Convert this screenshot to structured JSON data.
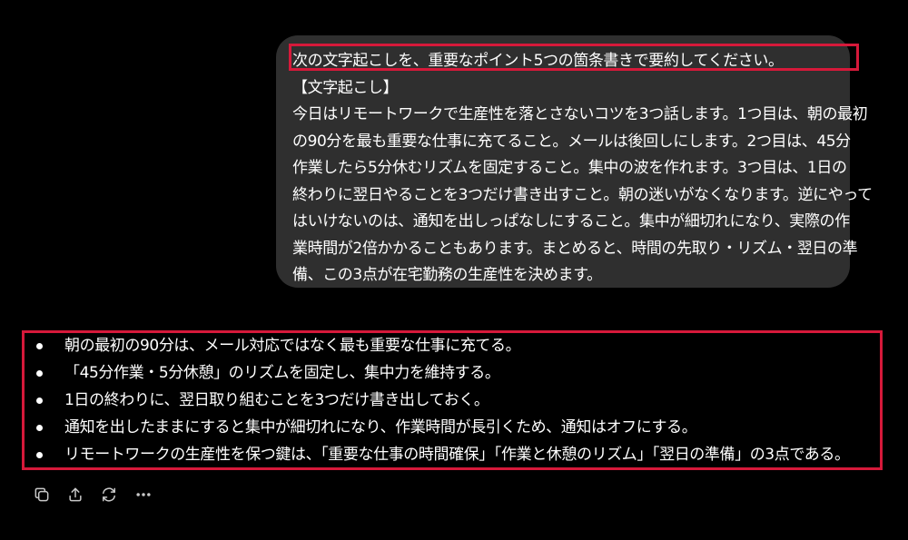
{
  "user_message": {
    "lines": [
      "次の文字起こしを、重要なポイント5つの箇条書きで要約してください。",
      "【文字起こし】",
      "今日はリモートワークで生産性を落とさないコツを3つ話します。1つ目は、朝の最初",
      "の90分を最も重要な仕事に充てること。メールは後回しにします。2つ目は、45分",
      "作業したら5分休むリズムを固定すること。集中の波を作れます。3つ目は、1日の",
      "終わりに翌日やることを3つだけ書き出すこと。朝の迷いがなくなります。逆にやって",
      "はいけないのは、通知を出しっぱなしにすること。集中が細切れになり、実際の作",
      "業時間が2倍かかることもあります。まとめると、時間の先取り・リズム・翌日の準",
      "備、この3点が在宅勤務の生産性を決めます。"
    ]
  },
  "assistant_response": {
    "bullets": [
      "朝の最初の90分は、メール対応ではなく最も重要な仕事に充てる。",
      "「45分作業・5分休憩」のリズムを固定し、集中力を維持する。",
      "1日の終わりに、翌日取り組むことを3つだけ書き出しておく。",
      "通知を出したままにすると集中が細切れになり、作業時間が長引くため、通知はオフにする。",
      "リモートワークの生産性を保つ鍵は、「重要な仕事の時間確保」「作業と休憩のリズム」「翌日の準備」の3点である。"
    ]
  },
  "actions": {
    "icons": [
      "copy-icon",
      "share-icon",
      "regenerate-icon",
      "more-icon"
    ]
  },
  "colors": {
    "background": "#000000",
    "bubble": "#2f2f2f",
    "highlight": "#d6193a",
    "text": "#ffffff",
    "icon": "#c8c8c8"
  }
}
